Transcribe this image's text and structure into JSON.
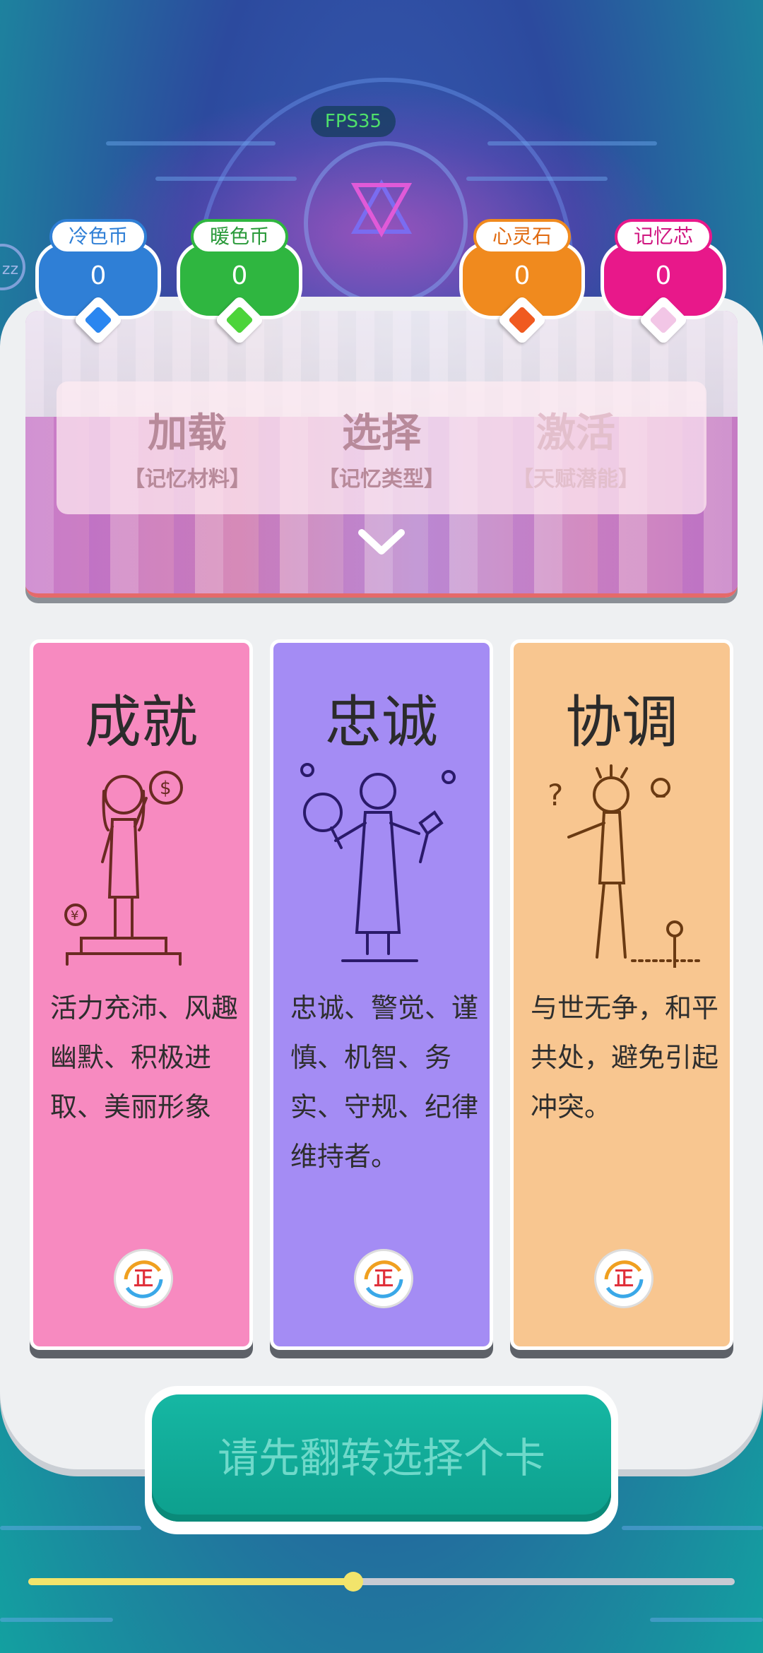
{
  "hud": {
    "fps_label": "FPS35"
  },
  "currencies": [
    {
      "name": "冷色币",
      "value": "0",
      "color": "#2f7fd6",
      "text_color": "#2f7fd6",
      "gem_color": "#2a86f0"
    },
    {
      "name": "暖色币",
      "value": "0",
      "color": "#2fb640",
      "text_color": "#2a9a3a",
      "gem_color": "#4cd43a"
    },
    {
      "name": "心灵石",
      "value": "0",
      "color": "#f08a1e",
      "text_color": "#e06a10",
      "gem_color": "#f05a20"
    },
    {
      "name": "记忆芯",
      "value": "0",
      "color": "#e8188a",
      "text_color": "#d01680",
      "gem_color": "#f2c6e6"
    }
  ],
  "steps": [
    {
      "title": "加载",
      "sub": "【记忆材料】",
      "state": "active"
    },
    {
      "title": "选择",
      "sub": "【记忆类型】",
      "state": "active"
    },
    {
      "title": "激活",
      "sub": "【天赋潜能】",
      "state": "inactive"
    }
  ],
  "cards": [
    {
      "title": "成就",
      "desc": "活力充沛、风趣幽默、积极进取、美丽形象",
      "color": "#f78ac0",
      "flip_label": "正",
      "art": "woman-on-podium"
    },
    {
      "title": "忠诚",
      "desc": "忠诚、警觉、谨慎、机智、务实、守规、纪律维持者。",
      "color": "#a48cf4",
      "flip_label": "正",
      "art": "man-with-tools"
    },
    {
      "title": "协调",
      "desc": "与世无争，和平共处，避免引起冲突。",
      "color": "#f8c690",
      "flip_label": "正",
      "art": "man-with-flower"
    }
  ],
  "action_button": {
    "label": "请先翻转选择个卡",
    "enabled": false
  },
  "progress": {
    "fraction": 0.46
  }
}
